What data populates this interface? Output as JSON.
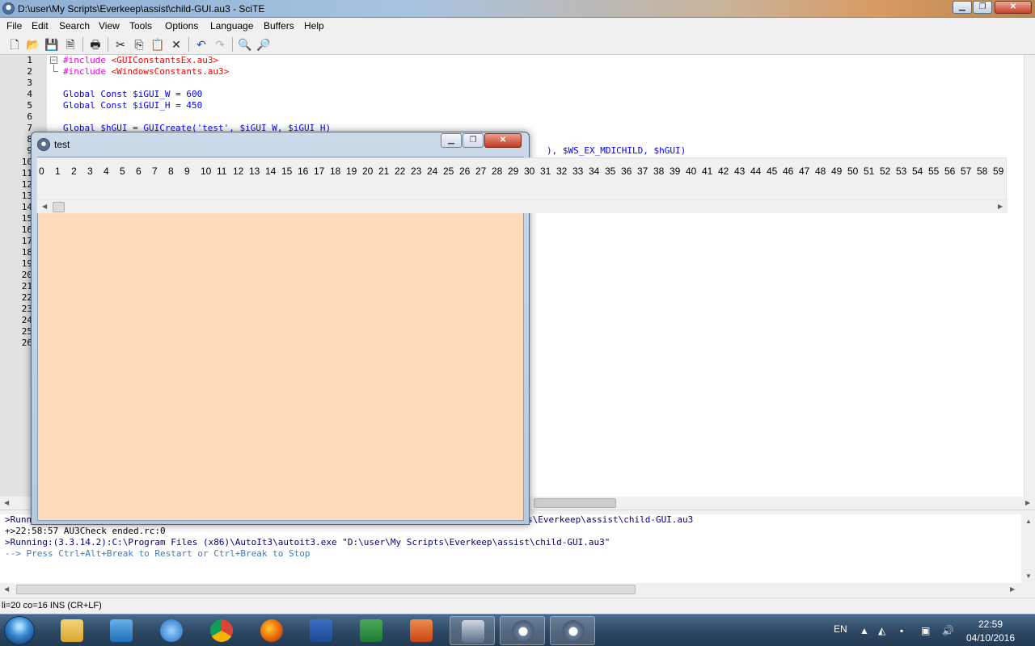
{
  "window": {
    "title": "D:\\user\\My Scripts\\Everkeep\\assist\\child-GUI.au3 - SciTE",
    "minimize_glyph": "▁",
    "maximize_glyph": "❐",
    "close_glyph": "✕"
  },
  "menu": [
    "File",
    "Edit",
    "Search",
    "View",
    "Tools",
    "Options",
    "Language",
    "Buffers",
    "Help"
  ],
  "toolbar_icons": [
    "new-file-icon",
    "open-folder-icon",
    "save-icon",
    "close-file-icon",
    "print-icon",
    "cut-icon",
    "copy-icon",
    "paste-icon",
    "delete-icon",
    "undo-icon",
    "redo-icon",
    "find-icon",
    "replace-icon"
  ],
  "editor": {
    "line_numbers": [
      "1",
      "2",
      "3",
      "4",
      "5",
      "6",
      "7",
      "8",
      "9",
      "10",
      "11",
      "12",
      "13",
      "14",
      "15",
      "16",
      "17",
      "18",
      "19",
      "20",
      "21",
      "22",
      "23",
      "24",
      "25",
      "26"
    ],
    "lines": {
      "l1_dir": "#include",
      "l1_inc": " <GUIConstantsEx.au3>",
      "l2_dir": "#include",
      "l2_inc": " <WindowsConstants.au3>",
      "l4": "Global Const $iGUI_W = 600",
      "l5": "Global Const $iGUI_H = 450",
      "l7": "Global $hGUI = GUICreate('test', $iGUI_W, $iGUI_H)",
      "l9_visible": "), $WS_EX_MDICHILD, $hGUI)"
    }
  },
  "output": {
    "line1": ">Running",
    "line1_tail": "s\\Everkeep\\assist\\child-GUI.au3",
    "line2": "+>22:58:57 AU3Check ended.rc:0",
    "line3": ">Running:(3.3.14.2):C:\\Program Files (x86)\\AutoIt3\\autoit3.exe \"D:\\user\\My Scripts\\Everkeep\\assist\\child-GUI.au3\"",
    "line4": "--> Press Ctrl+Alt+Break to Restart or Ctrl+Break to Stop"
  },
  "status": "li=20 co=16 INS (CR+LF)",
  "child_window": {
    "title": "test",
    "client_color": "#ffdbbb"
  },
  "strip_numbers": [
    "0",
    "1",
    "2",
    "3",
    "4",
    "5",
    "6",
    "7",
    "8",
    "9",
    "10",
    "11",
    "12",
    "13",
    "14",
    "15",
    "16",
    "17",
    "18",
    "19",
    "20",
    "21",
    "22",
    "23",
    "24",
    "25",
    "26",
    "27",
    "28",
    "29",
    "30",
    "31",
    "32",
    "33",
    "34",
    "35",
    "36",
    "37",
    "38",
    "39",
    "40",
    "41",
    "42",
    "43",
    "44",
    "45",
    "46",
    "47",
    "48",
    "49",
    "50",
    "51",
    "52",
    "53",
    "54",
    "55",
    "56",
    "57",
    "58",
    "59"
  ],
  "taskbar": {
    "apps": [
      "explorer-icon",
      "media-player-icon",
      "internet-explorer-icon",
      "chrome-icon",
      "firefox-icon",
      "word-icon",
      "excel-icon",
      "powerpoint-icon",
      "remote-desktop-icon",
      "autoit-icon",
      "autoit-gui-icon"
    ],
    "lang": "EN",
    "time": "22:59",
    "date": "04/10/2016"
  },
  "colors": {
    "keyword": "#0000ff",
    "include_path": "#ff0000",
    "child_background": "#ffdbbb"
  }
}
